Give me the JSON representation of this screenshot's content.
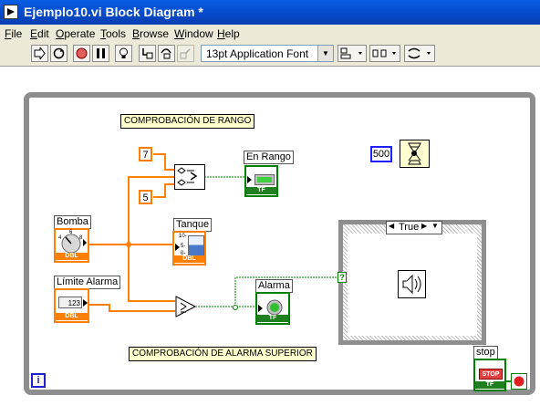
{
  "window": {
    "title": "Ejemplo10.vi Block Diagram *"
  },
  "menu": [
    "File",
    "Edit",
    "Operate",
    "Tools",
    "Browse",
    "Window",
    "Help"
  ],
  "toolbar": {
    "font_selector": "13pt Application Font"
  },
  "diagram": {
    "comment_range": "COMPROBACIÓN DE RANGO",
    "comment_alarm": "COMPROBACIÓN DE ALARMA SUPERIOR",
    "const_upper": "7",
    "const_lower": "5",
    "const_wait": "500",
    "label_bomba": "Bomba",
    "label_limite": "Límite Alarma",
    "label_tanque": "Tanque",
    "label_en_rango": "En Rango",
    "label_alarma": "Alarma",
    "label_stop": "stop",
    "case_selector": "True",
    "tag_dbl": "DBL",
    "tag_tf": "TF",
    "limite_value": "123",
    "stop_btn": "STOP",
    "info_icon": "i",
    "tanque_scale": [
      "10-",
      "5-",
      "0-"
    ],
    "case_term": "?",
    "bomba_marks": [
      "4",
      "6",
      "8"
    ]
  },
  "colors": {
    "orange_wire": "#ff7f00",
    "bool_wire": "#008000",
    "loop_border": "#8e8e8e"
  }
}
